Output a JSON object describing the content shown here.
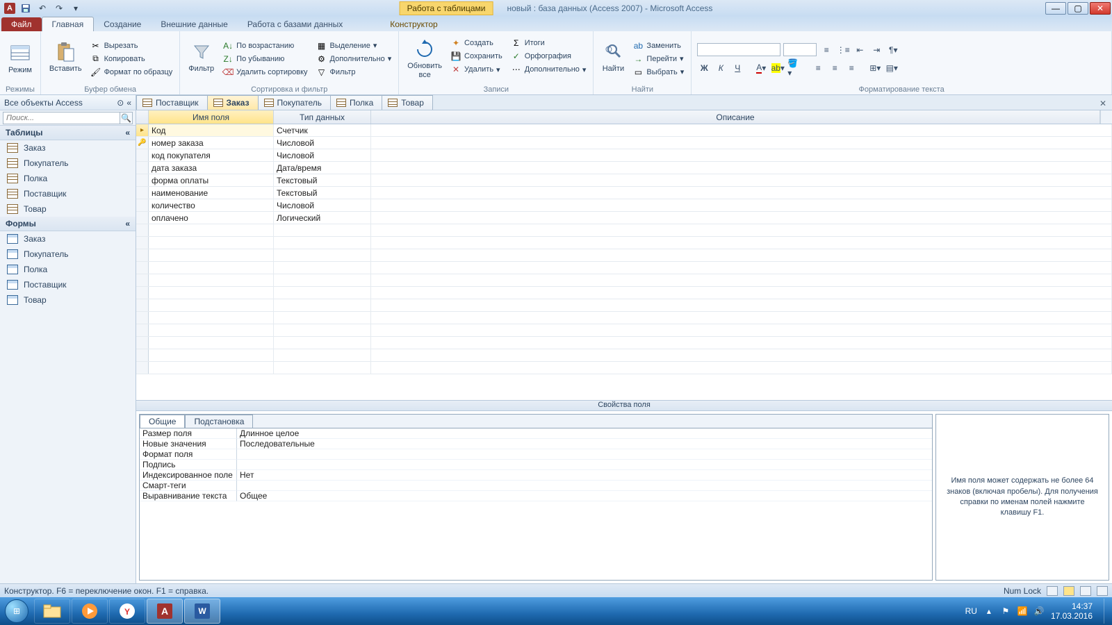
{
  "title": {
    "context_label": "Работа с таблицами",
    "document": "новый : база данных (Access 2007) - Microsoft Access"
  },
  "ribbon": {
    "file": "Файл",
    "tabs": [
      "Главная",
      "Создание",
      "Внешние данные",
      "Работа с базами данных",
      "Конструктор"
    ],
    "group_views": {
      "label": "Режимы",
      "btn": "Режим"
    },
    "group_clipboard": {
      "label": "Буфер обмена",
      "paste": "Вставить",
      "cut": "Вырезать",
      "copy": "Копировать",
      "format_painter": "Формат по образцу"
    },
    "group_sort": {
      "label": "Сортировка и фильтр",
      "filter": "Фильтр",
      "asc": "По возрастанию",
      "desc": "По убыванию",
      "clear": "Удалить сортировку",
      "selection": "Выделение",
      "advanced": "Дополнительно",
      "toggle": "Фильтр"
    },
    "group_records": {
      "label": "Записи",
      "refresh": "Обновить\nвсе",
      "new": "Создать",
      "save": "Сохранить",
      "delete": "Удалить",
      "totals": "Итоги",
      "spelling": "Орфография",
      "more": "Дополнительно"
    },
    "group_find": {
      "label": "Найти",
      "find": "Найти",
      "replace": "Заменить",
      "goto": "Перейти",
      "select": "Выбрать"
    },
    "group_textfmt": {
      "label": "Форматирование текста"
    }
  },
  "navpane": {
    "title": "Все объекты Access",
    "search_placeholder": "Поиск...",
    "group_tables": "Таблицы",
    "group_forms": "Формы",
    "tables": [
      "Заказ",
      "Покупатель",
      "Полка",
      "Поставщик",
      "Товар"
    ],
    "forms": [
      "Заказ",
      "Покупатель",
      "Полка",
      "Поставщик",
      "Товар"
    ]
  },
  "doctabs": [
    "Поставщик",
    "Заказ",
    "Покупатель",
    "Полка",
    "Товар"
  ],
  "grid": {
    "col_name": "Имя поля",
    "col_type": "Тип данных",
    "col_desc": "Описание",
    "rows": [
      {
        "name": "Код",
        "type": "Счетчик",
        "key": false,
        "current": true
      },
      {
        "name": "номер заказа",
        "type": "Числовой",
        "key": true
      },
      {
        "name": "код покупателя",
        "type": "Числовой"
      },
      {
        "name": "дата заказа",
        "type": "Дата/время"
      },
      {
        "name": "форма оплаты",
        "type": "Текстовый"
      },
      {
        "name": "наименование",
        "type": "Текстовый"
      },
      {
        "name": "количество",
        "type": "Числовой"
      },
      {
        "name": "оплачено",
        "type": "Логический"
      }
    ]
  },
  "properties": {
    "header": "Свойства поля",
    "tab_general": "Общие",
    "tab_lookup": "Подстановка",
    "rows": [
      {
        "label": "Размер поля",
        "value": "Длинное целое"
      },
      {
        "label": "Новые значения",
        "value": "Последовательные"
      },
      {
        "label": "Формат поля",
        "value": ""
      },
      {
        "label": "Подпись",
        "value": ""
      },
      {
        "label": "Индексированное поле",
        "value": "Нет"
      },
      {
        "label": "Смарт-теги",
        "value": ""
      },
      {
        "label": "Выравнивание текста",
        "value": "Общее"
      }
    ],
    "help": "Имя поля может содержать не более 64 знаков (включая пробелы). Для получения справки по именам полей нажмите клавишу F1."
  },
  "statusbar": {
    "left": "Конструктор.  F6 = переключение окон.  F1 = справка.",
    "numlock": "Num Lock"
  },
  "taskbar": {
    "lang": "RU",
    "time": "14:37",
    "date": "17.03.2016"
  }
}
